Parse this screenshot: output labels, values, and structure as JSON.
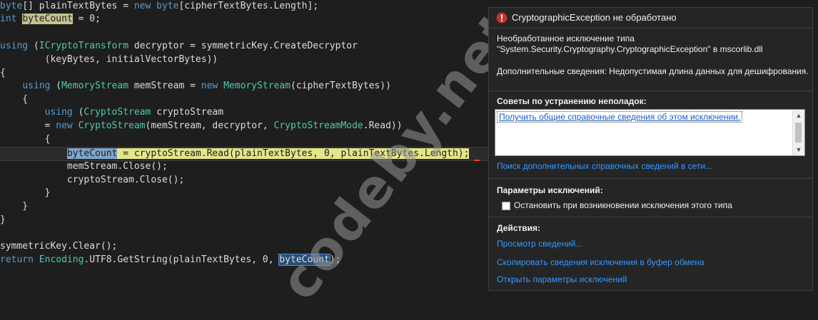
{
  "code": {
    "lines": [
      [
        {
          "c": "kw",
          "t": "byte"
        },
        {
          "c": "tok",
          "t": "[] plainTextBytes = "
        },
        {
          "c": "kw",
          "t": "new "
        },
        {
          "c": "kw",
          "t": "byte"
        },
        {
          "c": "tok",
          "t": "[cipherTextBytes.Length];"
        }
      ],
      [
        {
          "c": "kw",
          "t": "int "
        },
        {
          "c": "hl-yellow",
          "t": "byteCount"
        },
        {
          "c": "tok",
          "t": " = 0;"
        }
      ],
      [],
      [
        {
          "c": "kw",
          "t": "using "
        },
        {
          "c": "tok",
          "t": "("
        },
        {
          "c": "ty",
          "t": "ICryptoTransform"
        },
        {
          "c": "tok",
          "t": " decryptor = symmetricKey.CreateDecryptor"
        }
      ],
      [
        {
          "c": "tok",
          "t": "        (keyBytes, initialVectorBytes))"
        }
      ],
      [
        {
          "c": "tok",
          "t": "{"
        }
      ],
      [
        {
          "c": "tok",
          "t": "    "
        },
        {
          "c": "kw",
          "t": "using "
        },
        {
          "c": "tok",
          "t": "("
        },
        {
          "c": "ty",
          "t": "MemoryStream"
        },
        {
          "c": "tok",
          "t": " memStream = "
        },
        {
          "c": "kw",
          "t": "new "
        },
        {
          "c": "ty",
          "t": "MemoryStream"
        },
        {
          "c": "tok",
          "t": "(cipherTextBytes))"
        }
      ],
      [
        {
          "c": "tok",
          "t": "    {"
        }
      ],
      [
        {
          "c": "tok",
          "t": "        "
        },
        {
          "c": "kw",
          "t": "using "
        },
        {
          "c": "tok",
          "t": "("
        },
        {
          "c": "ty",
          "t": "CryptoStream"
        },
        {
          "c": "tok",
          "t": " cryptoStream"
        }
      ],
      [
        {
          "c": "tok",
          "t": "        = "
        },
        {
          "c": "kw",
          "t": "new "
        },
        {
          "c": "ty",
          "t": "CryptoStream"
        },
        {
          "c": "tok",
          "t": "(memStream, decryptor, "
        },
        {
          "c": "ty",
          "t": "CryptoStreamMode"
        },
        {
          "c": "tok",
          "t": ".Read))"
        }
      ],
      [
        {
          "c": "tok",
          "t": "        {"
        }
      ],
      [
        {
          "c": "tok",
          "t": "            "
        },
        {
          "c": "hl-exec",
          "parts": [
            {
              "c": "hl-blue",
              "t": "byteCount"
            },
            {
              "c": "tok",
              "t": " = cryptoStream.Read(plainTextBytes, 0, plainTextBytes.Length);"
            }
          ]
        }
      ],
      [
        {
          "c": "tok",
          "t": "            memStream.Close();"
        }
      ],
      [
        {
          "c": "tok",
          "t": "            cryptoStream.Close();"
        }
      ],
      [
        {
          "c": "tok",
          "t": "        }"
        }
      ],
      [
        {
          "c": "tok",
          "t": "    }"
        }
      ],
      [
        {
          "c": "tok",
          "t": "}"
        }
      ],
      [],
      [
        {
          "c": "tok",
          "t": "symmetricKey.Clear();"
        }
      ],
      [
        {
          "c": "kw",
          "t": "return "
        },
        {
          "c": "ty",
          "t": "Encoding"
        },
        {
          "c": "tok",
          "t": ".UTF8.GetString(plainTextBytes, 0, "
        },
        {
          "c": "hl-blue",
          "t": "byteCount"
        },
        {
          "c": "tok",
          "t": ");"
        }
      ]
    ],
    "current_line_index": 11
  },
  "watermark": "codeby.net",
  "exception": {
    "title": "CryptographicException не обработано",
    "message_line1": "Необработанное исключение типа",
    "message_line2": "\"System.Security.Cryptography.CryptographicException\" в mscorlib.dll",
    "details": "Дополнительные сведения: Недопустимая длина данных для дешифрования.",
    "tips_title": "Советы по устранению неполадок:",
    "tip_link": "Получить общие справочные сведения об этом исключении.",
    "search_online_link": "Поиск дополнительных справочных сведений в сети...",
    "settings_title": "Параметры исключений:",
    "break_checkbox_label": "Остановить при возникновении исключения этого типа",
    "break_checked": false,
    "actions_title": "Действия:",
    "actions": [
      "Просмотр сведений...",
      "Скопировать сведения исключения в буфер обмена",
      "Открыть параметры исключений"
    ]
  },
  "colors": {
    "editor_bg": "#1e1e1e",
    "keyword": "#569cd6",
    "type": "#4ec9b0",
    "panel_bg": "#252526",
    "link": "#3399ff",
    "warning": "#c93030"
  },
  "icons": {
    "header": "warning-icon"
  }
}
